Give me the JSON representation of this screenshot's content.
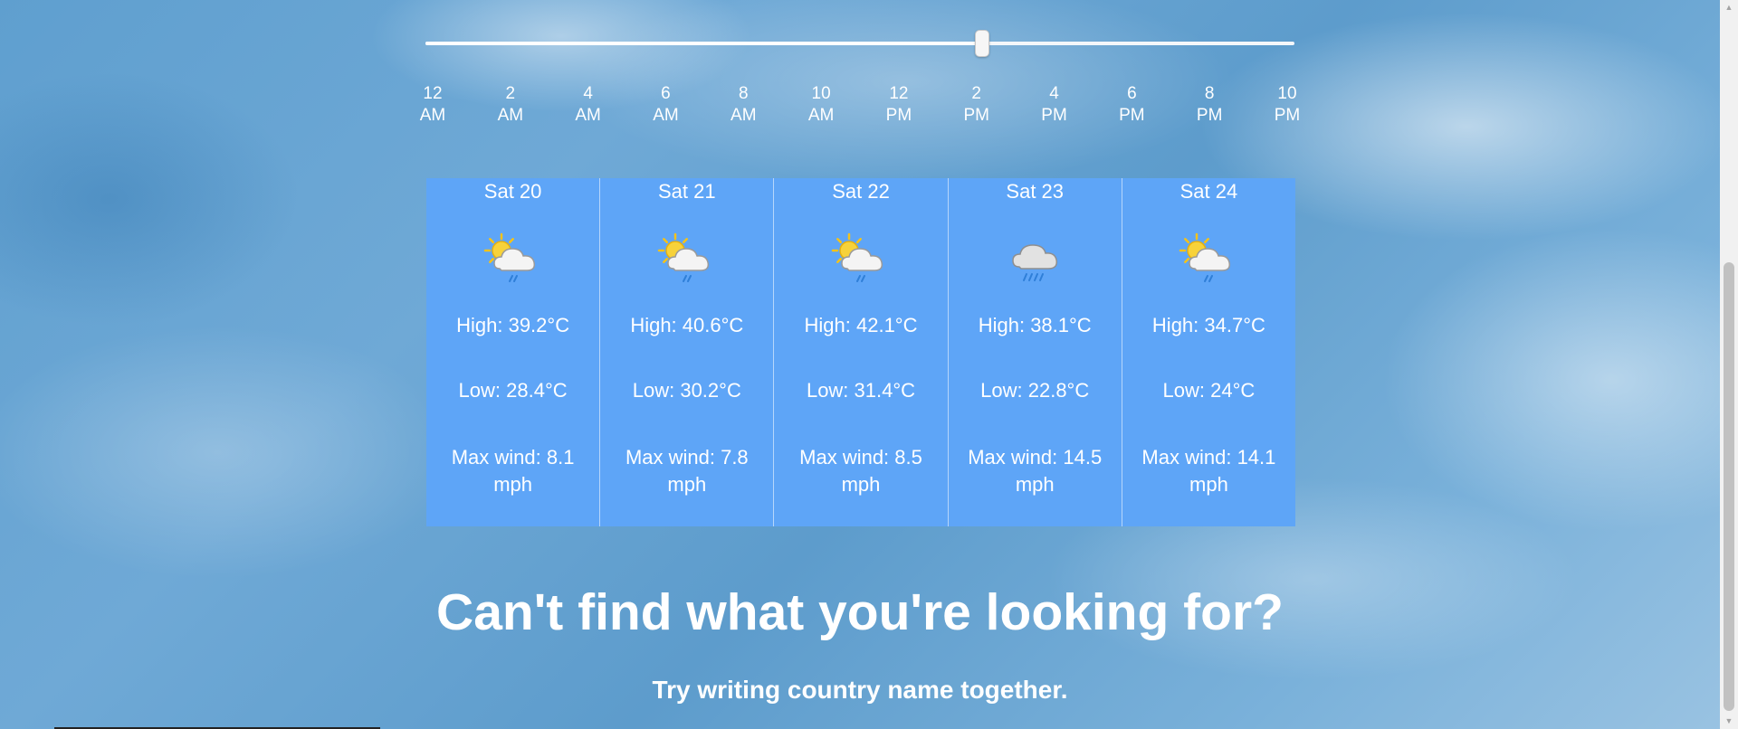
{
  "timeline": {
    "value_fraction": 0.64,
    "ticks": [
      {
        "hour": "12",
        "period": "AM"
      },
      {
        "hour": "2",
        "period": "AM"
      },
      {
        "hour": "4",
        "period": "AM"
      },
      {
        "hour": "6",
        "period": "AM"
      },
      {
        "hour": "8",
        "period": "AM"
      },
      {
        "hour": "10",
        "period": "AM"
      },
      {
        "hour": "12",
        "period": "PM"
      },
      {
        "hour": "2",
        "period": "PM"
      },
      {
        "hour": "4",
        "period": "PM"
      },
      {
        "hour": "6",
        "period": "PM"
      },
      {
        "hour": "8",
        "period": "PM"
      },
      {
        "hour": "10",
        "period": "PM"
      }
    ]
  },
  "forecast": {
    "days": [
      {
        "title": "Sat 20",
        "icon": "sun-cloud-rain-icon",
        "high": "High: 39.2°C",
        "low": "Low: 28.4°C",
        "wind": "Max wind: 8.1 mph"
      },
      {
        "title": "Sat 21",
        "icon": "sun-cloud-rain-icon",
        "high": "High: 40.6°C",
        "low": "Low: 30.2°C",
        "wind": "Max wind: 7.8 mph"
      },
      {
        "title": "Sat 22",
        "icon": "sun-cloud-rain-icon",
        "high": "High: 42.1°C",
        "low": "Low: 31.4°C",
        "wind": "Max wind: 8.5 mph"
      },
      {
        "title": "Sat 23",
        "icon": "cloud-rain-icon",
        "high": "High: 38.1°C",
        "low": "Low: 22.8°C",
        "wind": "Max wind: 14.5 mph"
      },
      {
        "title": "Sat 24",
        "icon": "sun-cloud-rain-icon",
        "high": "High: 34.7°C",
        "low": "Low: 24°C",
        "wind": "Max wind: 14.1 mph"
      }
    ]
  },
  "help": {
    "heading": "Can't find what you're looking for?",
    "tip": "Try writing country name together."
  },
  "colors": {
    "card_background": "#5ea5f7",
    "text": "#ffffff"
  }
}
